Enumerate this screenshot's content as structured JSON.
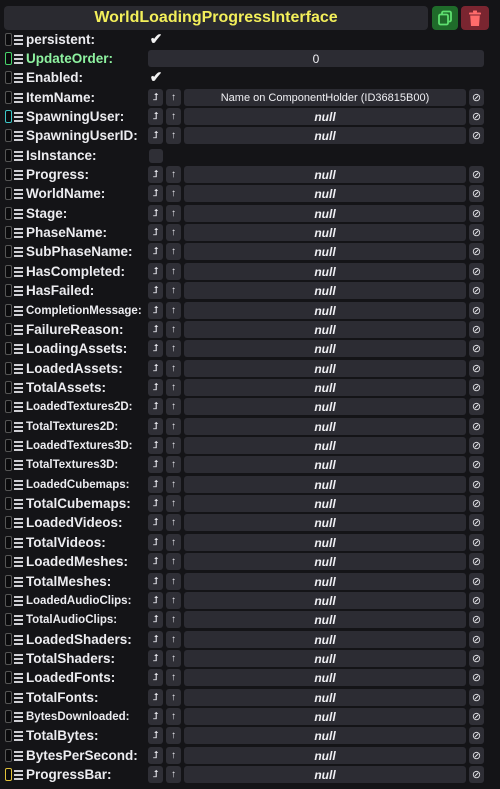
{
  "header": {
    "title": "WorldLoadingProgressInterface",
    "duplicate_icon": "duplicate-icon",
    "delete_icon": "trash-icon",
    "colors": {
      "title": "#f3ef5a",
      "duplicate_bg": "#1f6b2a",
      "delete_bg": "#7a2530"
    }
  },
  "null_text": "null",
  "clear_glyph": "⊘",
  "ref_glyph": "⮥",
  "up_glyph": "↑",
  "check_glyph": "✔",
  "fields": {
    "persistent": {
      "label": "persistent:",
      "checked": true
    },
    "update_order": {
      "label": "UpdateOrder:",
      "value": "0"
    },
    "enabled": {
      "label": "Enabled:",
      "checked": true
    },
    "item_name": {
      "label": "ItemName:",
      "value": "Name on ComponentHolder (ID36815B00)"
    },
    "spawning_user": {
      "label": "SpawningUser:"
    },
    "spawning_user_id": {
      "label": "SpawningUserID:"
    },
    "is_instance": {
      "label": "IsInstance:",
      "checked": false
    }
  },
  "null_fields": [
    "Progress:",
    "WorldName:",
    "Stage:",
    "PhaseName:",
    "SubPhaseName:",
    "HasCompleted:",
    "HasFailed:",
    "CompletionMessage:",
    "FailureReason:",
    "LoadingAssets:",
    "LoadedAssets:",
    "TotalAssets:",
    "LoadedTextures2D:",
    "TotalTextures2D:",
    "LoadedTextures3D:",
    "TotalTextures3D:",
    "LoadedCubemaps:",
    "TotalCubemaps:",
    "LoadedVideos:",
    "TotalVideos:",
    "LoadedMeshes:",
    "TotalMeshes:",
    "LoadedAudioClips:",
    "TotalAudioClips:",
    "LoadedShaders:",
    "TotalShaders:",
    "LoadedFonts:",
    "TotalFonts:",
    "BytesDownloaded:",
    "TotalBytes:",
    "BytesPerSecond:",
    "ProgressBar:"
  ]
}
